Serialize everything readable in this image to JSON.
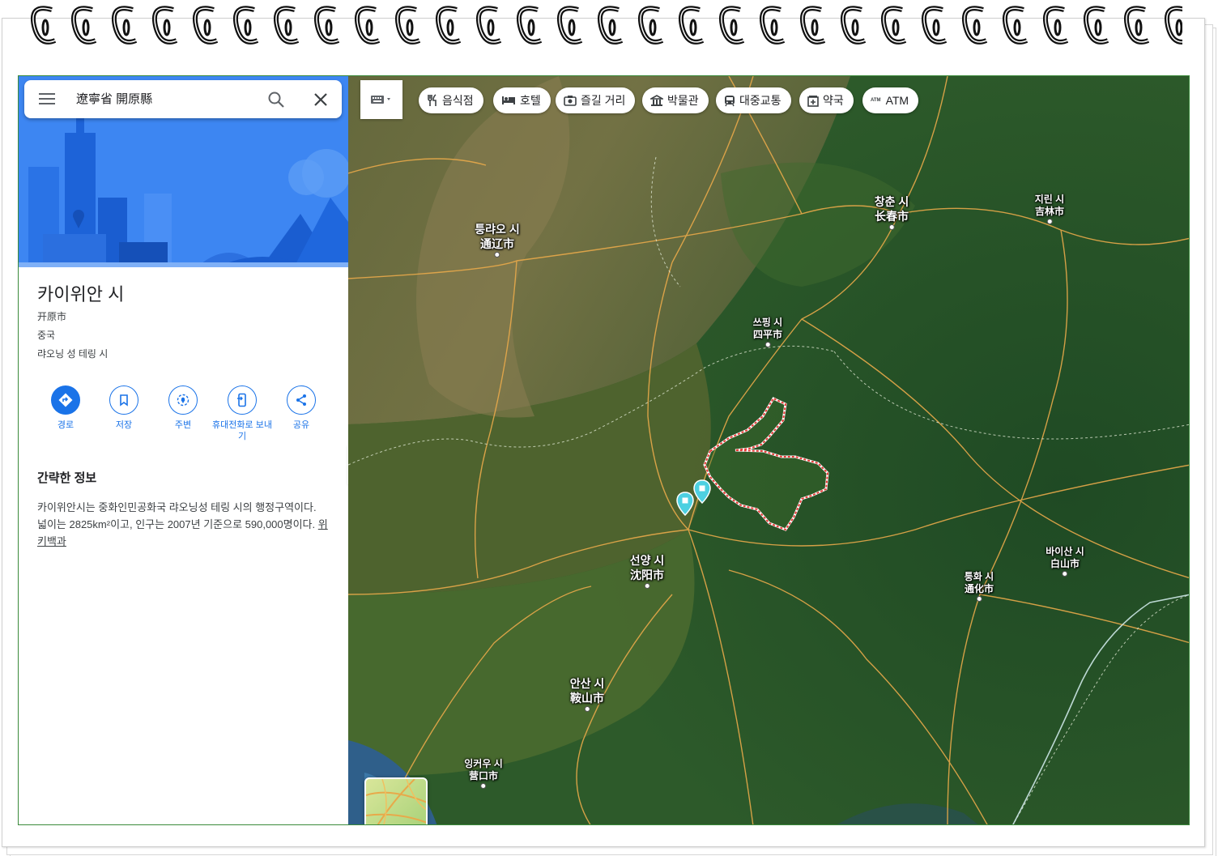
{
  "search": {
    "query": "遼寧省 開原縣"
  },
  "place": {
    "title": "카이위안 시",
    "native_name": "开原市",
    "country": "중국",
    "region": "랴오닝 성 테링 시"
  },
  "actions": [
    {
      "label": "경로"
    },
    {
      "label": "저장"
    },
    {
      "label": "주변"
    },
    {
      "label": "휴대전화로 보내기"
    },
    {
      "label": "공유"
    }
  ],
  "summary": {
    "heading": "간략한 정보",
    "text": "카이위안시는 중화인민공화국 랴오닝성 테링 시의 행정구역이다. 넓이는 2825km²이고, 인구는 2007년 기준으로 590,000명이다.",
    "link_label": "위키백과"
  },
  "chips": [
    {
      "label": "음식점",
      "icon": "restaurant-icon"
    },
    {
      "label": "호텔",
      "icon": "hotel-icon"
    },
    {
      "label": "즐길 거리",
      "icon": "camera-icon"
    },
    {
      "label": "박물관",
      "icon": "museum-icon"
    },
    {
      "label": "대중교통",
      "icon": "transit-icon"
    },
    {
      "label": "약국",
      "icon": "pharmacy-icon"
    },
    {
      "label": "ATM",
      "icon": "atm-icon",
      "icon_text": "ATM"
    }
  ],
  "cities": [
    {
      "kr": "퉁랴오 시",
      "cn": "通辽市"
    },
    {
      "kr": "창춘 시",
      "cn": "长春市"
    },
    {
      "kr": "지린 시",
      "cn": "吉林市"
    },
    {
      "kr": "쓰핑 시",
      "cn": "四平市"
    },
    {
      "kr": "선양 시",
      "cn": "沈阳市"
    },
    {
      "kr": "바이산 시",
      "cn": "白山市"
    },
    {
      "kr": "퉁화 시",
      "cn": "通化市"
    },
    {
      "kr": "안산 시",
      "cn": "鞍山市"
    },
    {
      "kr": "잉커우 시",
      "cn": "营口市"
    }
  ],
  "colors": {
    "accent": "#1a73e8",
    "boundary": "#e53935",
    "road": "#e8a94a",
    "frame": "#3a8a3a"
  }
}
